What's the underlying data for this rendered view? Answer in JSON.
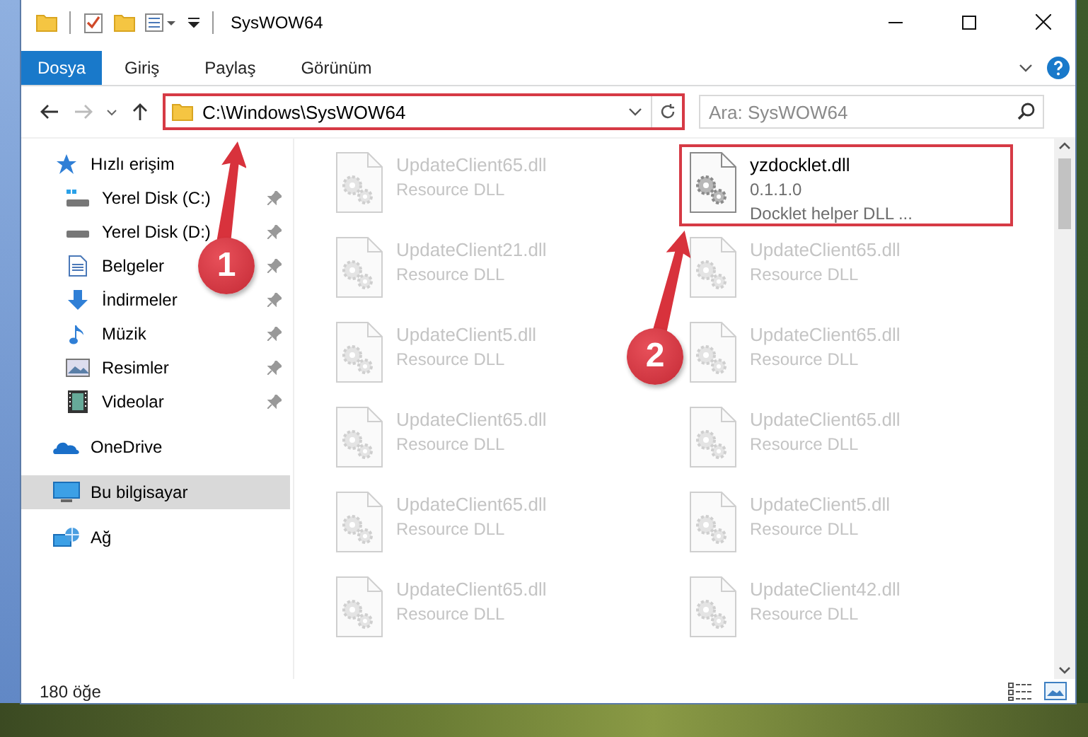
{
  "window": {
    "title": "SysWOW64"
  },
  "ribbon": {
    "tabs": [
      {
        "label": "Dosya",
        "selected": true
      },
      {
        "label": "Giriş",
        "selected": false
      },
      {
        "label": "Paylaş",
        "selected": false
      },
      {
        "label": "Görünüm",
        "selected": false
      }
    ]
  },
  "address_bar": {
    "path": "C:\\Windows\\SysWOW64",
    "highlighted": true
  },
  "search": {
    "placeholder": "Ara: SysWOW64"
  },
  "sidebar": {
    "items": [
      {
        "label": "Hızlı erişim",
        "selected": false,
        "children": [
          {
            "label": "Yerel Disk (C:)",
            "pinned": true,
            "selected": false
          },
          {
            "label": "Yerel Disk (D:)",
            "pinned": true,
            "selected": false
          },
          {
            "label": "Belgeler",
            "pinned": true,
            "selected": false
          },
          {
            "label": "İndirmeler",
            "pinned": true,
            "selected": false
          },
          {
            "label": "Müzik",
            "pinned": true,
            "selected": false
          },
          {
            "label": "Resimler",
            "pinned": true,
            "selected": false
          },
          {
            "label": "Videolar",
            "pinned": true,
            "selected": false
          }
        ]
      },
      {
        "label": "OneDrive",
        "selected": false
      },
      {
        "label": "Bu bilgisayar",
        "selected": true
      },
      {
        "label": "Ağ",
        "selected": false
      }
    ]
  },
  "files": [
    {
      "name": "UpdateClient65.dll",
      "details": [
        "Resource DLL"
      ],
      "dimmed": true,
      "highlighted": false
    },
    {
      "name": "yzdocklet.dll",
      "details": [
        "0.1.1.0",
        "Docklet helper DLL ..."
      ],
      "dimmed": false,
      "highlighted": true
    },
    {
      "name": "UpdateClient21.dll",
      "details": [
        "Resource DLL"
      ],
      "dimmed": true,
      "highlighted": false
    },
    {
      "name": "UpdateClient65.dll",
      "details": [
        "Resource DLL"
      ],
      "dimmed": true,
      "highlighted": false
    },
    {
      "name": "UpdateClient5.dll",
      "details": [
        "Resource DLL"
      ],
      "dimmed": true,
      "highlighted": false
    },
    {
      "name": "UpdateClient65.dll",
      "details": [
        "Resource DLL"
      ],
      "dimmed": true,
      "highlighted": false
    },
    {
      "name": "UpdateClient65.dll",
      "details": [
        "Resource DLL"
      ],
      "dimmed": true,
      "highlighted": false
    },
    {
      "name": "UpdateClient65.dll",
      "details": [
        "Resource DLL"
      ],
      "dimmed": true,
      "highlighted": false
    },
    {
      "name": "UpdateClient65.dll",
      "details": [
        "Resource DLL"
      ],
      "dimmed": true,
      "highlighted": false
    },
    {
      "name": "UpdateClient5.dll",
      "details": [
        "Resource DLL"
      ],
      "dimmed": true,
      "highlighted": false
    },
    {
      "name": "UpdateClient65.dll",
      "details": [
        "Resource DLL"
      ],
      "dimmed": true,
      "highlighted": false
    },
    {
      "name": "UpdateClient42.dll",
      "details": [
        "Resource DLL"
      ],
      "dimmed": true,
      "highlighted": false
    }
  ],
  "status_bar": {
    "count": "180 öğe"
  },
  "annotations": [
    {
      "number": "1"
    },
    {
      "number": "2"
    }
  ]
}
